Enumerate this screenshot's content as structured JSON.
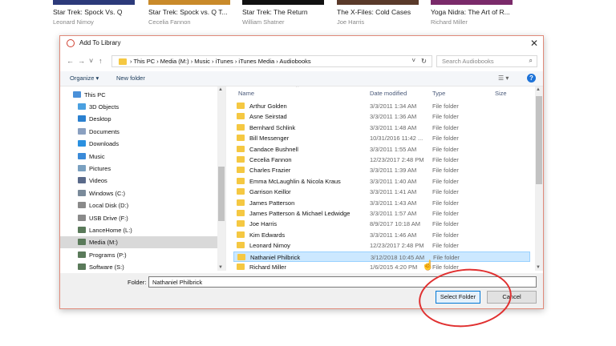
{
  "library": {
    "books": [
      {
        "title": "Star Trek: Spock Vs. Q",
        "author": "Leonard Nimoy",
        "color": "#2c3a7a"
      },
      {
        "title": "Star Trek: Spock vs. Q T...",
        "author": "Cecelia Fannon",
        "color": "#c98a2a"
      },
      {
        "title": "Star Trek: The Return",
        "author": "William Shatner",
        "color": "#111111"
      },
      {
        "title": "The X-Files: Cold Cases",
        "author": "Joe Harris",
        "color": "#5a3a2a"
      },
      {
        "title": "Yoga Nidra: The Art of R...",
        "author": "Richard Miller",
        "color": "#7a2a6a"
      }
    ]
  },
  "dialog": {
    "title": "Add To Library",
    "nav": {
      "back": "←",
      "forward": "→",
      "dropdown": "˅",
      "up": "↑"
    },
    "address": {
      "crumbs": "›  This PC  ›  Media (M:)  ›  Music  ›  iTunes  ›  iTunes Media  ›  Audiobooks",
      "dropdown": "˅",
      "refresh": "↻"
    },
    "search": {
      "placeholder": "Search Audiobooks",
      "icon": "⌕"
    },
    "toolbar": {
      "organize": "Organize ▾",
      "new_folder": "New folder",
      "view": "☰ ▾",
      "help": "?"
    },
    "sidebar": [
      {
        "label": "This PC",
        "icon": "monitor",
        "color": "#4a90d9"
      },
      {
        "label": "3D Objects",
        "icon": "cube",
        "color": "#4aa0e0"
      },
      {
        "label": "Desktop",
        "icon": "desktop",
        "color": "#2a80d0"
      },
      {
        "label": "Documents",
        "icon": "document",
        "color": "#8aa0c0"
      },
      {
        "label": "Downloads",
        "icon": "download",
        "color": "#2a90e0"
      },
      {
        "label": "Music",
        "icon": "music",
        "color": "#3a8ad8"
      },
      {
        "label": "Pictures",
        "icon": "picture",
        "color": "#7aa0c0"
      },
      {
        "label": "Videos",
        "icon": "video",
        "color": "#5a6a8a"
      },
      {
        "label": "Windows (C:)",
        "icon": "drive",
        "color": "#7a8a9a"
      },
      {
        "label": "Local Disk (D:)",
        "icon": "drive",
        "color": "#8a8a8a"
      },
      {
        "label": "USB Drive (F:)",
        "icon": "drive",
        "color": "#8a8a8a"
      },
      {
        "label": "LanceHome (L:)",
        "icon": "network-drive",
        "color": "#5a7a5a"
      },
      {
        "label": "Media (M:)",
        "icon": "network-drive",
        "color": "#5a7a5a",
        "selected": true
      },
      {
        "label": "Programs (P:)",
        "icon": "network-drive",
        "color": "#5a7a5a"
      },
      {
        "label": "Software (S:)",
        "icon": "network-drive",
        "color": "#5a7a5a"
      }
    ],
    "columns": {
      "name": "Name",
      "date": "Date modified",
      "type": "Type",
      "size": "Size"
    },
    "files": [
      {
        "name": "Arthur Golden",
        "date": "3/3/2011 1:34 AM",
        "type": "File folder"
      },
      {
        "name": "Asne Seirstad",
        "date": "3/3/2011 1:36 AM",
        "type": "File folder"
      },
      {
        "name": "Bernhard Schlink",
        "date": "3/3/2011 1:48 AM",
        "type": "File folder"
      },
      {
        "name": "Bill Messenger",
        "date": "10/31/2016 11:42 ...",
        "type": "File folder"
      },
      {
        "name": "Candace Bushnell",
        "date": "3/3/2011 1:55 AM",
        "type": "File folder"
      },
      {
        "name": "Cecelia Fannon",
        "date": "12/23/2017 2:48 PM",
        "type": "File folder"
      },
      {
        "name": "Charles Frazier",
        "date": "3/3/2011 1:39 AM",
        "type": "File folder"
      },
      {
        "name": "Emma McLaughlin & Nicola Kraus",
        "date": "3/3/2011 1:40 AM",
        "type": "File folder"
      },
      {
        "name": "Garrison Keillor",
        "date": "3/3/2011 1:41 AM",
        "type": "File folder"
      },
      {
        "name": "James Patterson",
        "date": "3/3/2011 1:43 AM",
        "type": "File folder"
      },
      {
        "name": "James Patterson & Michael Ledwidge",
        "date": "3/3/2011 1:57 AM",
        "type": "File folder"
      },
      {
        "name": "Joe Harris",
        "date": "8/9/2017 10:18 AM",
        "type": "File folder"
      },
      {
        "name": "Kim Edwards",
        "date": "3/3/2011 1:46 AM",
        "type": "File folder"
      },
      {
        "name": "Leonard Nimoy",
        "date": "12/23/2017 2:48 PM",
        "type": "File folder"
      },
      {
        "name": "Nathaniel Philbrick",
        "date": "3/12/2018 10:45 AM",
        "type": "File folder",
        "selected": true
      },
      {
        "name": "Richard Miller",
        "date": "1/6/2015 4:20 PM",
        "type": "File folder"
      }
    ],
    "folder_label": "Folder:",
    "folder_value": "Nathaniel Philbrick",
    "select_button": "Select Folder",
    "cancel_button": "Cancel"
  }
}
